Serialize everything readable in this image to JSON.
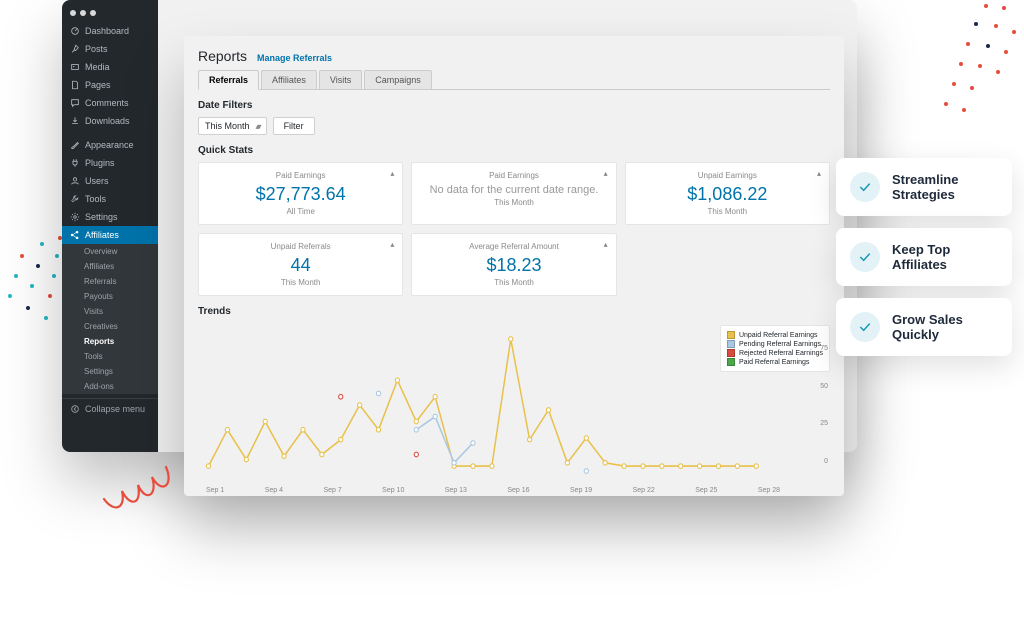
{
  "sidebar": {
    "primary": [
      {
        "label": "Dashboard",
        "icon": "dashboard"
      },
      {
        "label": "Posts",
        "icon": "pin"
      },
      {
        "label": "Media",
        "icon": "media"
      },
      {
        "label": "Pages",
        "icon": "page"
      },
      {
        "label": "Comments",
        "icon": "comment"
      },
      {
        "label": "Downloads",
        "icon": "download"
      }
    ],
    "secondary": [
      {
        "label": "Appearance",
        "icon": "brush"
      },
      {
        "label": "Plugins",
        "icon": "plug"
      },
      {
        "label": "Users",
        "icon": "user"
      },
      {
        "label": "Tools",
        "icon": "wrench"
      },
      {
        "label": "Settings",
        "icon": "gear"
      }
    ],
    "affiliates_label": "Affiliates",
    "submenu": [
      {
        "label": "Overview",
        "active": false
      },
      {
        "label": "Affiliates",
        "active": false
      },
      {
        "label": "Referrals",
        "active": false
      },
      {
        "label": "Payouts",
        "active": false
      },
      {
        "label": "Visits",
        "active": false
      },
      {
        "label": "Creatives",
        "active": false
      },
      {
        "label": "Reports",
        "active": true
      },
      {
        "label": "Tools",
        "active": false
      },
      {
        "label": "Settings",
        "active": false
      },
      {
        "label": "Add-ons",
        "active": false
      }
    ],
    "collapse_label": "Collapse menu"
  },
  "report": {
    "title": "Reports",
    "manage_link": "Manage Referrals",
    "tabs": [
      "Referrals",
      "Affiliates",
      "Visits",
      "Campaigns"
    ],
    "active_tab": 0,
    "date_filters_label": "Date Filters",
    "filter_select": "This Month",
    "filter_btn": "Filter",
    "quick_stats_label": "Quick Stats",
    "cards": [
      {
        "title": "Paid Earnings",
        "value": "$27,773.64",
        "sub": "All Time",
        "nodata": false
      },
      {
        "title": "Paid Earnings",
        "value": "No data for the current date range.",
        "sub": "This Month",
        "nodata": true
      },
      {
        "title": "Unpaid Earnings",
        "value": "$1,086.22",
        "sub": "This Month",
        "nodata": false
      },
      {
        "title": "Unpaid Referrals",
        "value": "44",
        "sub": "This Month",
        "nodata": false
      },
      {
        "title": "Average Referral Amount",
        "value": "$18.23",
        "sub": "This Month",
        "nodata": false
      }
    ],
    "trends_label": "Trends",
    "legend": [
      {
        "label": "Unpaid Referral Earnings",
        "color": "#e8c04a"
      },
      {
        "label": "Pending Referral Earnings",
        "color": "#a9c7e0"
      },
      {
        "label": "Rejected Referral Earnings",
        "color": "#d94a3f"
      },
      {
        "label": "Paid Referral Earnings",
        "color": "#4aa84a"
      }
    ],
    "yaxis_ticks": [
      "75",
      "50",
      "25",
      "0"
    ],
    "xaxis_labels": [
      "Sep 1",
      "Sep 4",
      "Sep 7",
      "Sep 10",
      "Sep 13",
      "Sep 16",
      "Sep 19",
      "Sep 22",
      "Sep 25",
      "Sep 28"
    ]
  },
  "side_cards": [
    "Streamline Strategies",
    "Keep Top Affiliates",
    "Grow Sales Quickly"
  ],
  "chart_data": {
    "type": "line",
    "title": "Trends",
    "xlabel": "",
    "ylabel": "",
    "ylim": [
      0,
      90
    ],
    "categories": [
      1,
      2,
      3,
      4,
      5,
      6,
      7,
      8,
      9,
      10,
      11,
      12,
      13,
      14,
      15,
      16,
      17,
      18,
      19,
      20,
      21,
      22,
      23,
      24,
      25,
      26,
      27,
      28,
      29,
      30
    ],
    "series": [
      {
        "name": "Unpaid Referral Earnings",
        "color": "#e8c04a",
        "values": [
          8,
          30,
          12,
          35,
          14,
          30,
          15,
          24,
          45,
          30,
          60,
          35,
          50,
          8,
          8,
          8,
          85,
          24,
          42,
          10,
          25,
          10,
          8,
          8,
          8,
          8,
          8,
          8,
          8,
          8
        ]
      },
      {
        "name": "Pending Referral Earnings",
        "color": "#a9c7e0",
        "values": [
          null,
          null,
          null,
          null,
          null,
          null,
          null,
          null,
          null,
          52,
          null,
          30,
          38,
          10,
          22,
          null,
          null,
          null,
          null,
          null,
          5,
          null,
          null,
          null,
          null,
          null,
          null,
          null,
          null,
          null
        ]
      },
      {
        "name": "Rejected Referral Earnings",
        "color": "#d94a3f",
        "values": [
          null,
          null,
          null,
          null,
          null,
          null,
          null,
          50,
          null,
          null,
          null,
          15,
          null,
          null,
          null,
          null,
          null,
          null,
          null,
          null,
          null,
          null,
          null,
          null,
          null,
          null,
          null,
          null,
          null,
          null
        ]
      },
      {
        "name": "Paid Referral Earnings",
        "color": "#4aa84a",
        "values": [
          null,
          null,
          null,
          null,
          null,
          null,
          null,
          null,
          null,
          null,
          null,
          null,
          null,
          null,
          null,
          null,
          null,
          null,
          null,
          null,
          null,
          null,
          null,
          null,
          null,
          null,
          null,
          null,
          null,
          null
        ]
      }
    ]
  }
}
